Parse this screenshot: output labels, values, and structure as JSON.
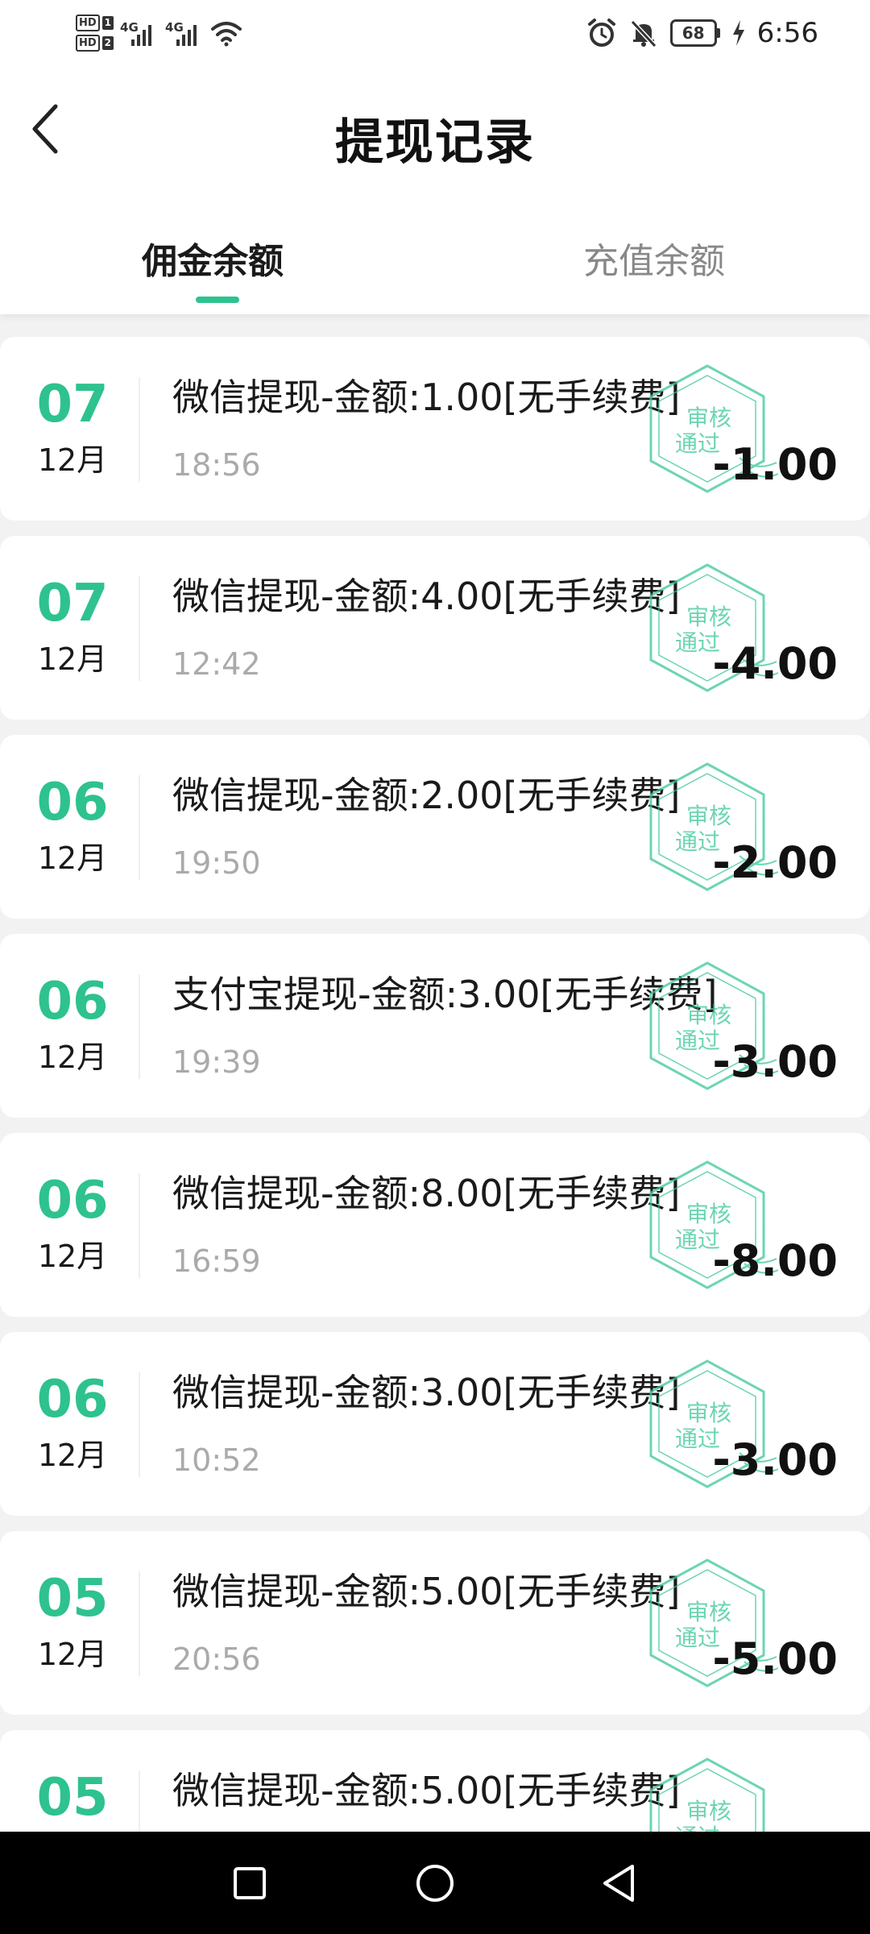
{
  "status_bar": {
    "sim1": {
      "hd": "HD",
      "num": "1"
    },
    "sim2": {
      "hd": "HD",
      "num": "2"
    },
    "signal1_label": "4G",
    "signal2_label": "4G",
    "battery": "68",
    "time": "6:56"
  },
  "header": {
    "title": "提现记录"
  },
  "tabs": [
    {
      "label": "佣金余额",
      "active": true
    },
    {
      "label": "充值余额",
      "active": false
    }
  ],
  "records": [
    {
      "day": "07",
      "month": "12月",
      "desc": "微信提现-金额:1.00[无手续费]",
      "time": "18:56",
      "amount": "-1.00",
      "stamp_line1": "审核",
      "stamp_line2": "通过"
    },
    {
      "day": "07",
      "month": "12月",
      "desc": "微信提现-金额:4.00[无手续费]",
      "time": "12:42",
      "amount": "-4.00",
      "stamp_line1": "审核",
      "stamp_line2": "通过"
    },
    {
      "day": "06",
      "month": "12月",
      "desc": "微信提现-金额:2.00[无手续费]",
      "time": "19:50",
      "amount": "-2.00",
      "stamp_line1": "审核",
      "stamp_line2": "通过"
    },
    {
      "day": "06",
      "month": "12月",
      "desc": "支付宝提现-金额:3.00[无手续费]",
      "time": "19:39",
      "amount": "-3.00",
      "stamp_line1": "审核",
      "stamp_line2": "通过"
    },
    {
      "day": "06",
      "month": "12月",
      "desc": "微信提现-金额:8.00[无手续费]",
      "time": "16:59",
      "amount": "-8.00",
      "stamp_line1": "审核",
      "stamp_line2": "通过"
    },
    {
      "day": "06",
      "month": "12月",
      "desc": "微信提现-金额:3.00[无手续费]",
      "time": "10:52",
      "amount": "-3.00",
      "stamp_line1": "审核",
      "stamp_line2": "通过"
    },
    {
      "day": "05",
      "month": "12月",
      "desc": "微信提现-金额:5.00[无手续费]",
      "time": "20:56",
      "amount": "-5.00",
      "stamp_line1": "审核",
      "stamp_line2": "通过"
    },
    {
      "day": "05",
      "month": "",
      "desc": "微信提现-金额:5.00[无手续费]",
      "time": "",
      "amount": "",
      "stamp_line1": "审核",
      "stamp_line2": "通过"
    }
  ],
  "colors": {
    "accent": "#2ec28e",
    "stamp": "#3cc79a",
    "background": "#f2f2f2"
  },
  "icons": {
    "back": "chevron-left-icon",
    "stamp": "approved-stamp-icon",
    "nav_recent": "square-icon",
    "nav_home": "circle-icon",
    "nav_back": "triangle-left-icon"
  }
}
